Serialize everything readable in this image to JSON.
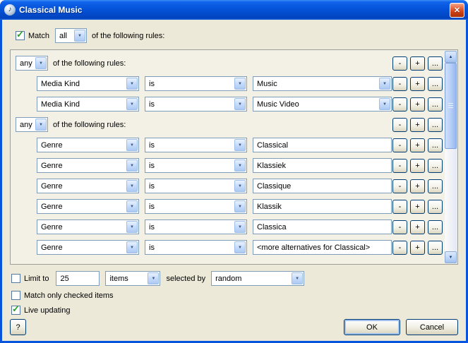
{
  "window": {
    "title": "Classical Music"
  },
  "icons": {
    "app": "♪",
    "close": "✕",
    "combo_arrow": "▼",
    "scroll_up": "▲",
    "scroll_down": "▼",
    "check": "✓"
  },
  "colors": {
    "titlebar_blue": "#0054E3",
    "close_red": "#D24215",
    "check_green": "#21A121",
    "dialog_bg": "#ECE9D8"
  },
  "match_row": {
    "label": "Match",
    "mode": "all",
    "suffix": "of the following rules:"
  },
  "rules": {
    "buttons": {
      "minus": "-",
      "plus": "+",
      "more": "..."
    },
    "group1": {
      "mode": "any",
      "label": "of the following rules:"
    },
    "rows1": [
      {
        "field": "Media Kind",
        "op": "is",
        "value": "Music"
      },
      {
        "field": "Media Kind",
        "op": "is",
        "value": "Music Video"
      }
    ],
    "group2": {
      "mode": "any",
      "label": "of the following rules:"
    },
    "rows2": [
      {
        "field": "Genre",
        "op": "is",
        "value": "Classical"
      },
      {
        "field": "Genre",
        "op": "is",
        "value": "Klassiek"
      },
      {
        "field": "Genre",
        "op": "is",
        "value": "Classique"
      },
      {
        "field": "Genre",
        "op": "is",
        "value": "Klassik"
      },
      {
        "field": "Genre",
        "op": "is",
        "value": "Classica"
      },
      {
        "field": "Genre",
        "op": "is",
        "value": "<more alternatives for Classical>"
      }
    ]
  },
  "limit_row": {
    "label": "Limit to",
    "count": "25",
    "unit": "items",
    "selected_by_label": "selected by",
    "order": "random"
  },
  "options": {
    "match_only_checked": "Match only checked items",
    "live_updating": "Live updating"
  },
  "footer": {
    "help": "?",
    "ok": "OK",
    "cancel": "Cancel"
  }
}
